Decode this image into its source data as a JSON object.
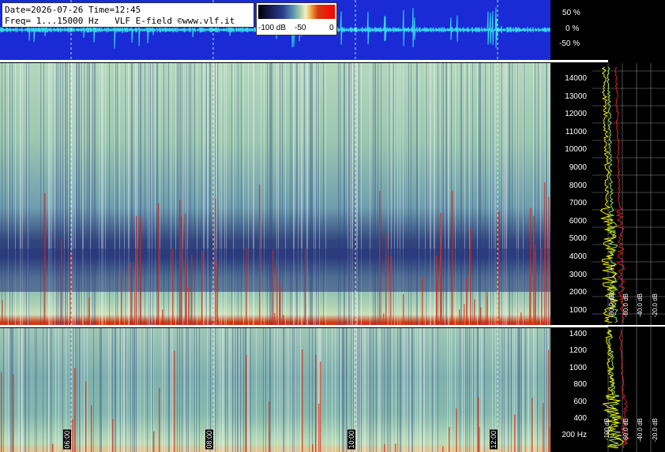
{
  "header": {
    "date_time": "Date=2026-07-26 Time=12:45",
    "freq_info": "Freq= 1...15000 Hz",
    "station": "VLF E-field ©www.vlf.it"
  },
  "colorbar": {
    "labels": [
      "-100 dB",
      "-50",
      "0"
    ]
  },
  "waveform_scale": [
    "50 %",
    "0 %",
    "-50 %"
  ],
  "freq_axis_top": [
    "14000",
    "13000",
    "12000",
    "11000",
    "10000",
    "9000",
    "8000",
    "7000",
    "6000",
    "5000",
    "4000",
    "3000",
    "2000",
    "1000"
  ],
  "freq_axis_bottom": [
    "1400",
    "1200",
    "1000",
    "800",
    "600",
    "400",
    "200 Hz"
  ],
  "time_labels": [
    "06:00",
    "08:00",
    "10:00",
    "12:00"
  ],
  "profile_db_labels_top": [
    "-20.0 dB",
    "-40.0 dB",
    "-60.0 dB",
    "-80.0 dB"
  ],
  "profile_db_labels_bottom": [
    "-20.0 dB",
    "-40.0 dB",
    "-60.0 dB",
    "-100 dB"
  ],
  "colors": {
    "waveform_bg": "#1a2bd6",
    "waveform_trace": "#33d8e8",
    "band_dark": "#2b3b7a",
    "impulse_red": "#d62a12",
    "profile_yellow": "#f0f000",
    "profile_green": "#9be05a",
    "profile_red": "#e02020"
  }
}
